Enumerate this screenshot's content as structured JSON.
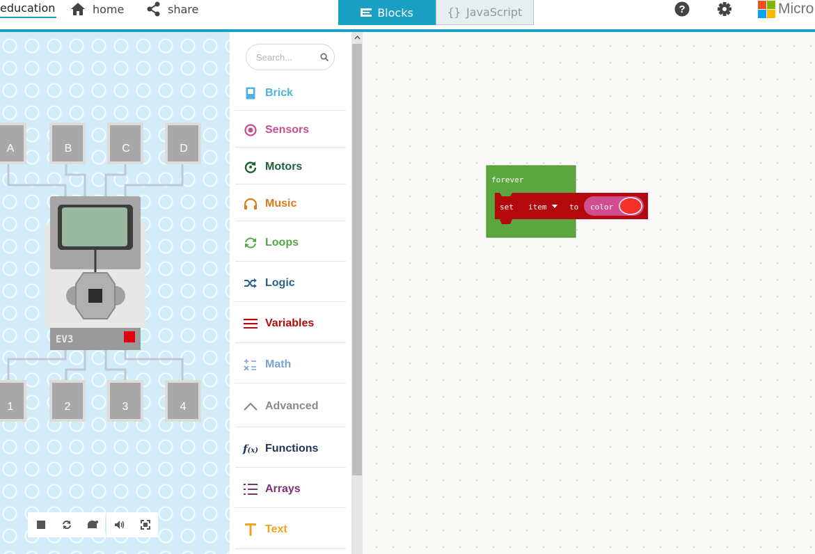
{
  "app": {
    "brand": "education",
    "nav": {
      "home": "home",
      "share": "share"
    },
    "tabs": {
      "blocks": "Blocks",
      "javascript": "JavaScript",
      "javascript_icon": "{}"
    },
    "ms_label": "Micro",
    "icons": [
      "home-icon",
      "share-icon",
      "help-icon",
      "settings-icon",
      "microsoft-logo"
    ]
  },
  "simulator": {
    "top_ports": [
      "A",
      "B",
      "C",
      "D"
    ],
    "bottom_ports": [
      "1",
      "2",
      "3",
      "4"
    ],
    "brick_label": "EV3",
    "controls": [
      "stop-icon",
      "restart-icon",
      "slow-motion-icon",
      "mute-icon",
      "fullscreen-icon"
    ]
  },
  "toolbox": {
    "search_placeholder": "Search...",
    "categories": [
      {
        "label": "Brick",
        "color": "#4fb1dd",
        "icon": "brick-icon"
      },
      {
        "label": "Sensors",
        "color": "#c94e8d",
        "icon": "sensor-icon"
      },
      {
        "label": "Motors",
        "color": "#1e5f39",
        "icon": "motor-icon"
      },
      {
        "label": "Music",
        "color": "#d97a1c",
        "icon": "headphones-icon"
      },
      {
        "label": "Loops",
        "color": "#53a546",
        "icon": "loop-icon"
      },
      {
        "label": "Logic",
        "color": "#275f8d",
        "icon": "shuffle-icon"
      },
      {
        "label": "Variables",
        "color": "#b3080c",
        "icon": "variables-icon"
      },
      {
        "label": "Math",
        "color": "#7aa3cf",
        "icon": "math-icon"
      },
      {
        "label": "Advanced",
        "color": "#8a8a8a",
        "icon": "chevron-up-icon"
      },
      {
        "label": "Functions",
        "color": "#1d3557",
        "icon": "function-icon"
      },
      {
        "label": "Arrays",
        "color": "#802f73",
        "icon": "list-icon"
      },
      {
        "label": "Text",
        "color": "#f0a31f",
        "icon": "text-icon"
      }
    ]
  },
  "workspace": {
    "forever_block": {
      "label": "forever",
      "color": "#5ba63f"
    },
    "set_block": {
      "label": "set",
      "variable": "item",
      "to": "to",
      "color": "#b3080c"
    },
    "color_block": {
      "label": "color",
      "value": "#f43029",
      "color": "#d24c90"
    }
  }
}
